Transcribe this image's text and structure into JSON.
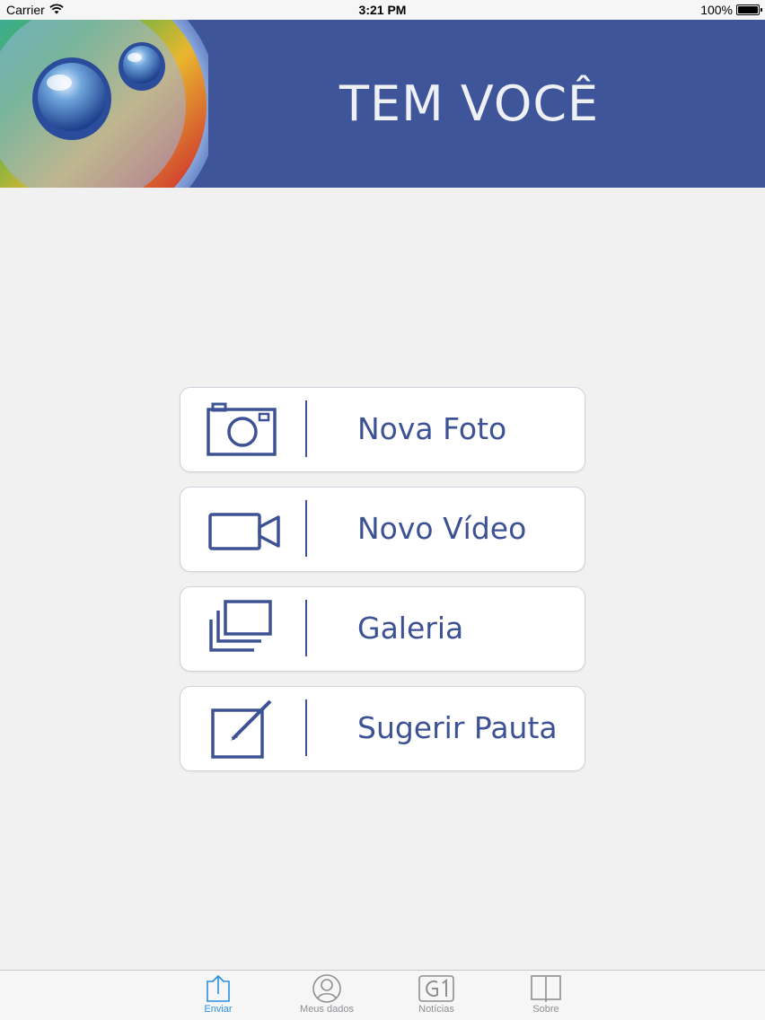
{
  "status_bar": {
    "carrier": "Carrier",
    "time": "3:21 PM",
    "battery": "100%",
    "battery_level": 1.0
  },
  "banner": {
    "title": "TEM VOCÊ",
    "background_color": "#3f5599"
  },
  "menu": {
    "items": [
      {
        "label": "Nova Foto",
        "icon": "camera-icon"
      },
      {
        "label": "Novo Vídeo",
        "icon": "video-camera-icon"
      },
      {
        "label": "Galeria",
        "icon": "gallery-icon"
      },
      {
        "label": "Sugerir Pauta",
        "icon": "edit-icon"
      }
    ],
    "accent_color": "#3d5294"
  },
  "tab_bar": {
    "tabs": [
      {
        "label": "Enviar",
        "icon": "upload-icon",
        "active": true
      },
      {
        "label": "Meus dados",
        "icon": "user-icon",
        "active": false
      },
      {
        "label": "Notícias",
        "icon": "g1-icon",
        "active": false
      },
      {
        "label": "Sobre",
        "icon": "book-icon",
        "active": false
      }
    ],
    "active_color": "#2b8fe0",
    "inactive_color": "#8e8e93"
  }
}
